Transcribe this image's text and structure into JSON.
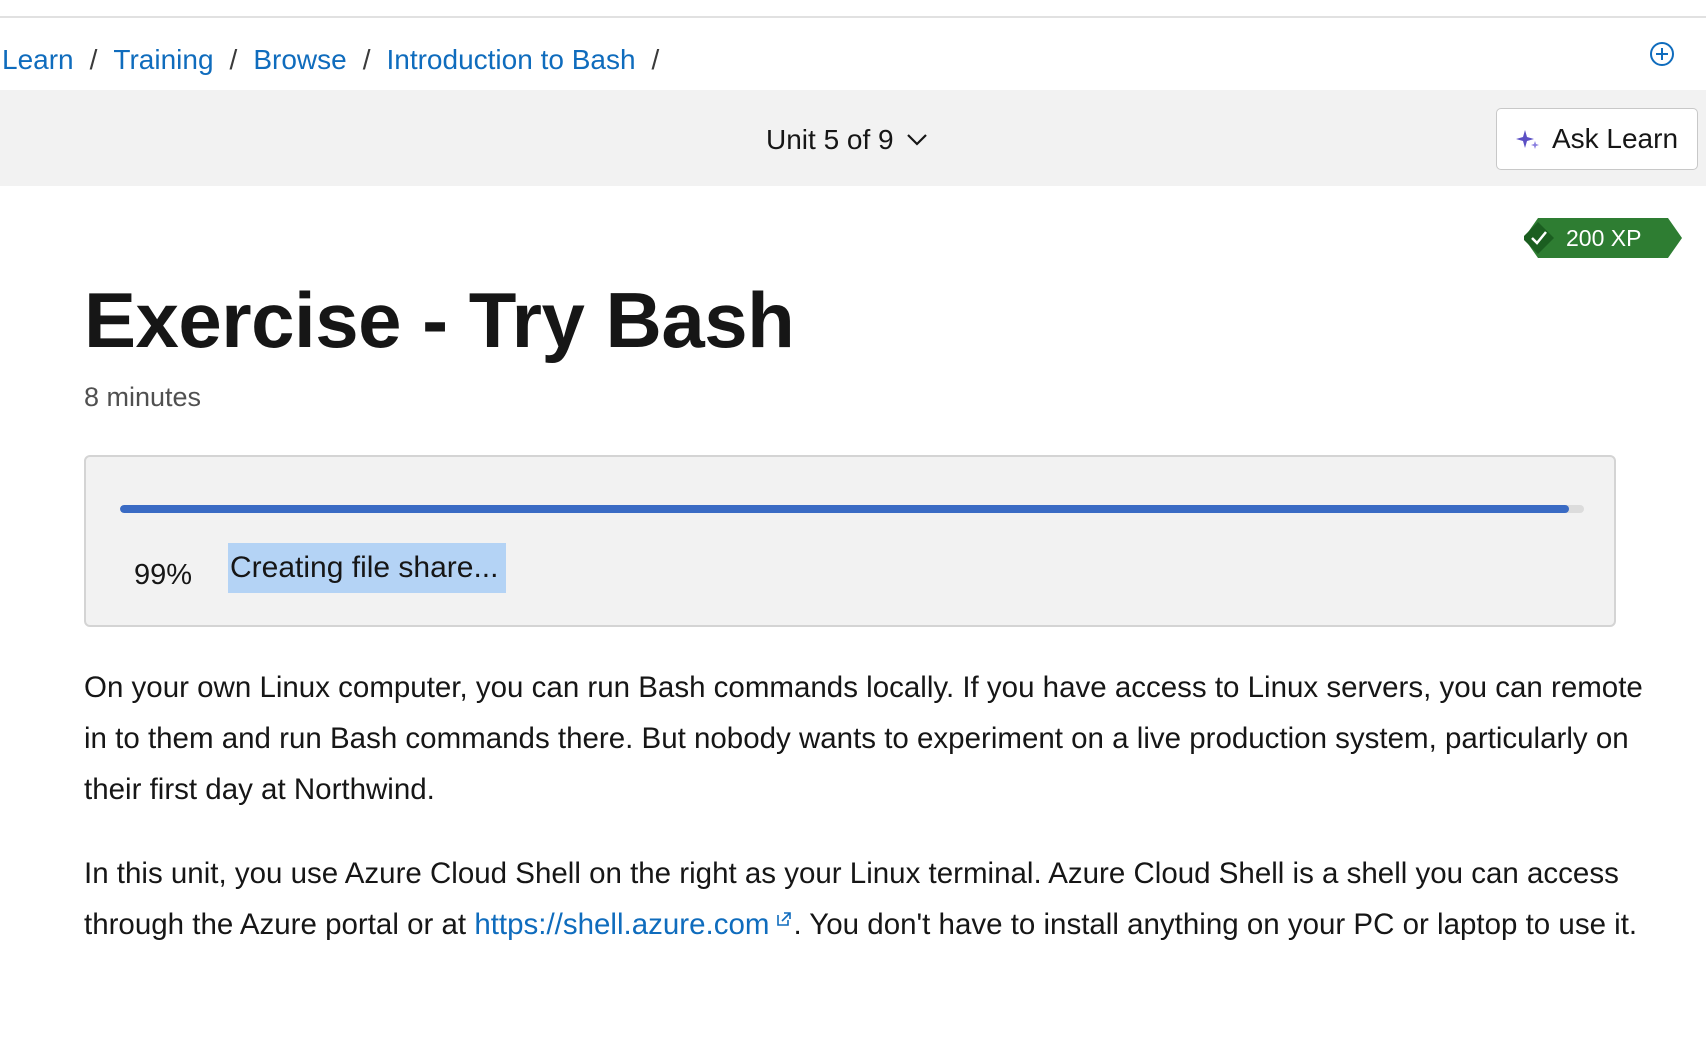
{
  "breadcrumb": {
    "items": [
      "Learn",
      "Training",
      "Browse",
      "Introduction to Bash"
    ],
    "separator": "/"
  },
  "unit_bar": {
    "unit_label": "Unit 5 of 9",
    "ask_learn_label": "Ask Learn"
  },
  "xp_badge": {
    "label": "200 XP"
  },
  "page": {
    "title": "Exercise - Try Bash",
    "duration": "8 minutes"
  },
  "progress": {
    "percent_label": "99%",
    "value": 99,
    "status": "Creating file share..."
  },
  "content": {
    "para1": "On your own Linux computer, you can run Bash commands locally. If you have access to Linux servers, you can remote in to them and run Bash commands there. But nobody wants to experiment on a live production system, particularly on their first day at Northwind.",
    "para2_before": "In this unit, you use Azure Cloud Shell on the right as your Linux terminal. Azure Cloud Shell is a shell you can access through the Azure portal or at ",
    "para2_link": "https://shell.azure.com",
    "para2_after": ". You don't have to install anything on your PC or laptop to use it."
  },
  "icons": {
    "add": "add-circle-icon",
    "chevron": "chevron-down-icon",
    "sparkle": "sparkle-icon",
    "check": "checkmark-icon",
    "external": "external-link-icon"
  },
  "colors": {
    "link": "#0f6cbd",
    "progress_fill": "#3a6bc4",
    "xp_badge": "#2e7d32",
    "highlight": "#b4d3f5"
  }
}
